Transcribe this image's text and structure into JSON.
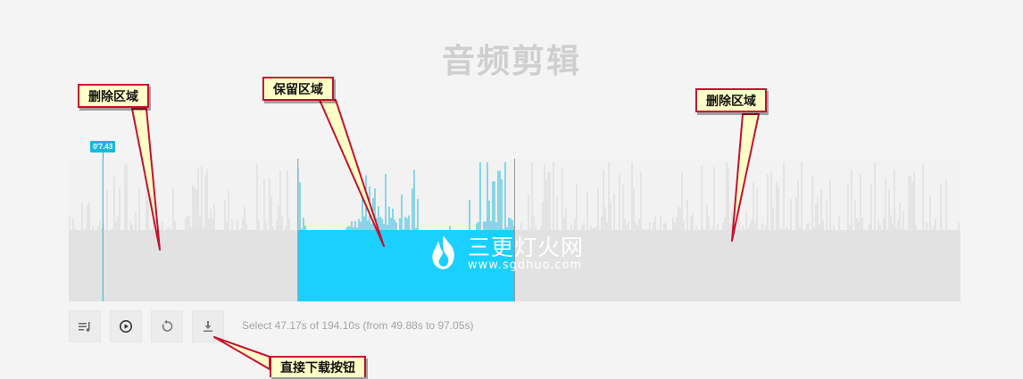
{
  "header": {
    "title": "音频剪辑"
  },
  "waveform": {
    "duration_s": 194.1,
    "selection_start_s": 49.88,
    "selection_end_s": 97.05,
    "playhead_s": 7.43,
    "playhead_label": "0'7.43",
    "colors": {
      "background": "#f2f2f2",
      "unselected_fill": "#e2e2e2",
      "selected_fill": "#1ad0ff",
      "bars_unselected": "#d5d5d5",
      "bars_selected": "#1ab8e0",
      "cursor": "#1ab8e0",
      "boundary": "#9a9a9a"
    }
  },
  "toolbar": {
    "buttons": [
      {
        "name": "playlist-button",
        "icon": "playlist-icon"
      },
      {
        "name": "play-button",
        "icon": "play-circle-icon"
      },
      {
        "name": "reset-button",
        "icon": "undo-icon"
      },
      {
        "name": "download-button",
        "icon": "download-icon"
      }
    ],
    "status": "Select 47.17s of 194.10s (from 49.88s to 97.05s)"
  },
  "annotations": {
    "delete_left": "删除区域",
    "keep": "保留区域",
    "delete_right": "删除区域",
    "download": "直接下载按钮",
    "border_color": "#c8102e",
    "fill_color": "#ffffc7"
  },
  "watermark": {
    "brand": "三更灯火网",
    "url": "www.sgdhuo.com"
  }
}
